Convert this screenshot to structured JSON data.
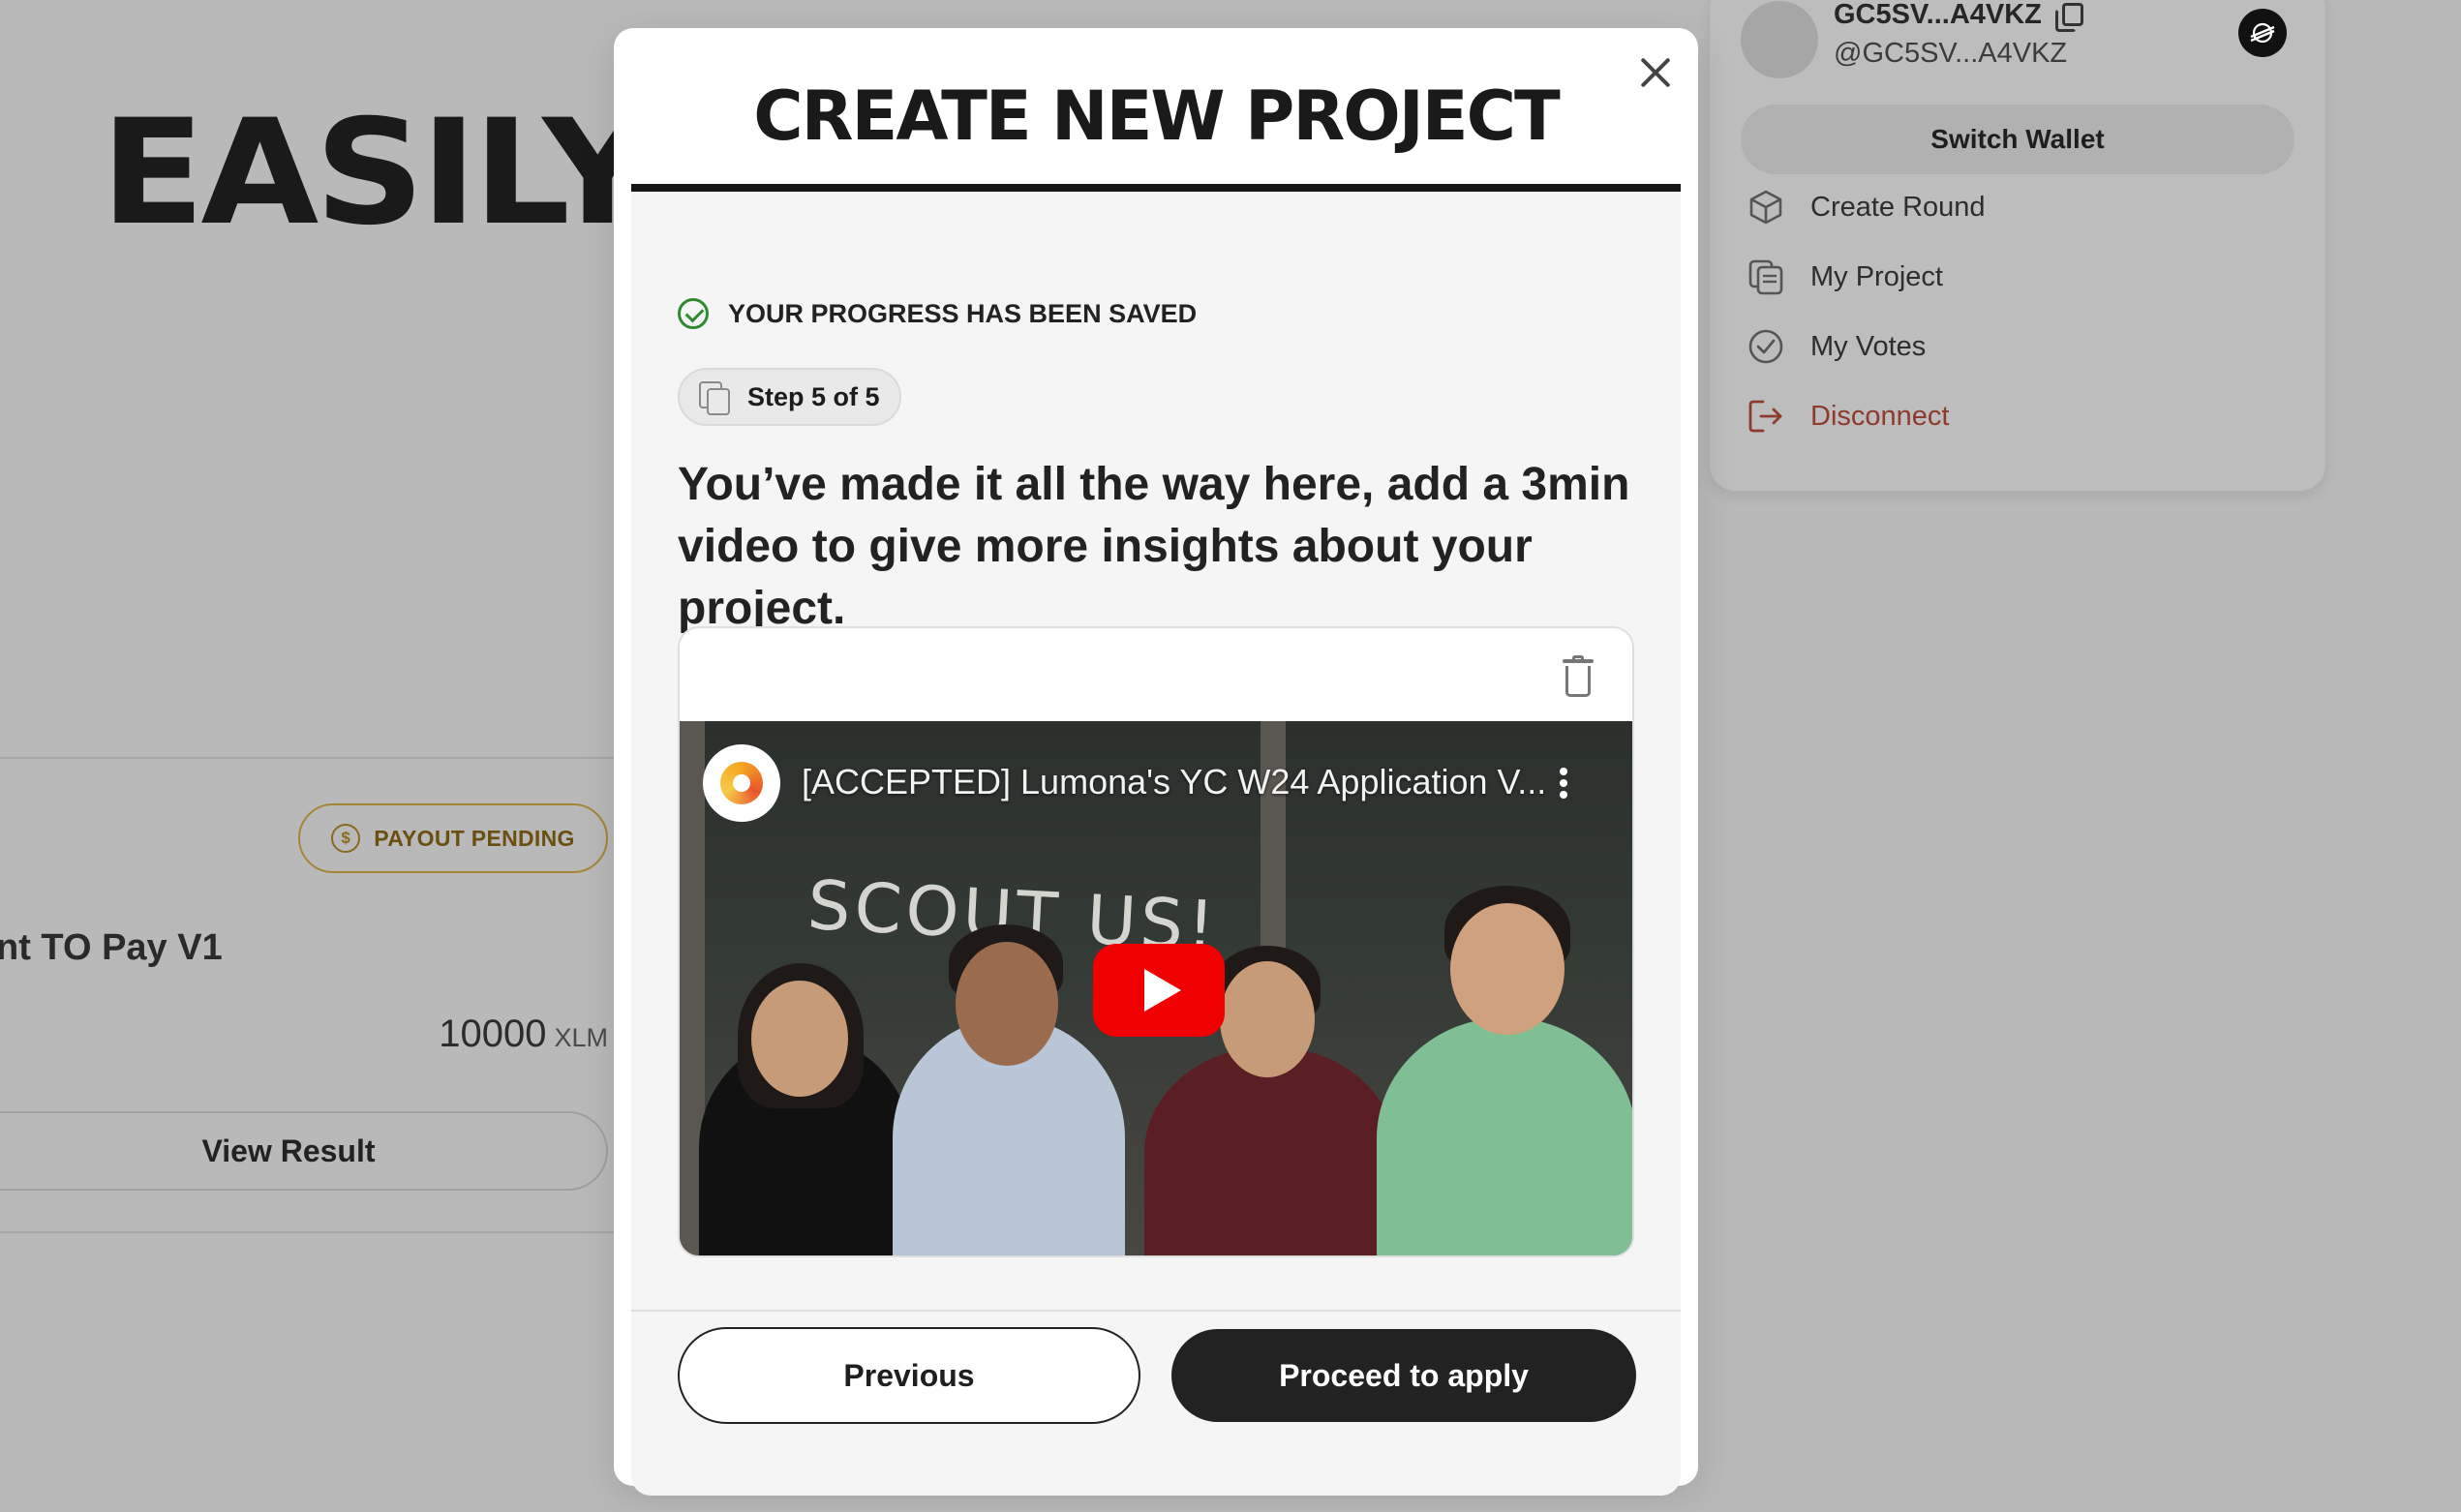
{
  "background": {
    "heading": "EASILY I",
    "card": {
      "status_badge": "PAYOUT PENDING",
      "title": "nt TO Pay V1",
      "amount": "10000",
      "currency": "XLM",
      "view_result_label": "View Result"
    }
  },
  "wallet_menu": {
    "address": "GC5SV...A4VKZ",
    "handle": "@GC5SV...A4VKZ",
    "switch_wallet_label": "Switch Wallet",
    "items": [
      {
        "label": "Create Round",
        "icon": "cube-icon"
      },
      {
        "label": "My Project",
        "icon": "documents-icon"
      },
      {
        "label": "My Votes",
        "icon": "check-circle-icon"
      },
      {
        "label": "Disconnect",
        "icon": "logout-icon"
      }
    ]
  },
  "modal": {
    "title": "CREATE NEW PROJECT",
    "saved_status": "YOUR PROGRESS HAS BEEN SAVED",
    "step_label": "Step 5 of 5",
    "prompt": "You’ve made it all the way here, add a 3min video to give more insights about your project.",
    "video": {
      "title": "[ACCEPTED] Lumona's YC W24 Application V...",
      "chalk_text": "SCOUT US!"
    },
    "previous_label": "Previous",
    "proceed_label": "Proceed to apply"
  },
  "colors": {
    "accent_dark": "#222222",
    "success": "#2f8a2f",
    "danger": "#8e3a2c",
    "youtube_red": "#f00000",
    "badge_gold": "#a68636"
  }
}
